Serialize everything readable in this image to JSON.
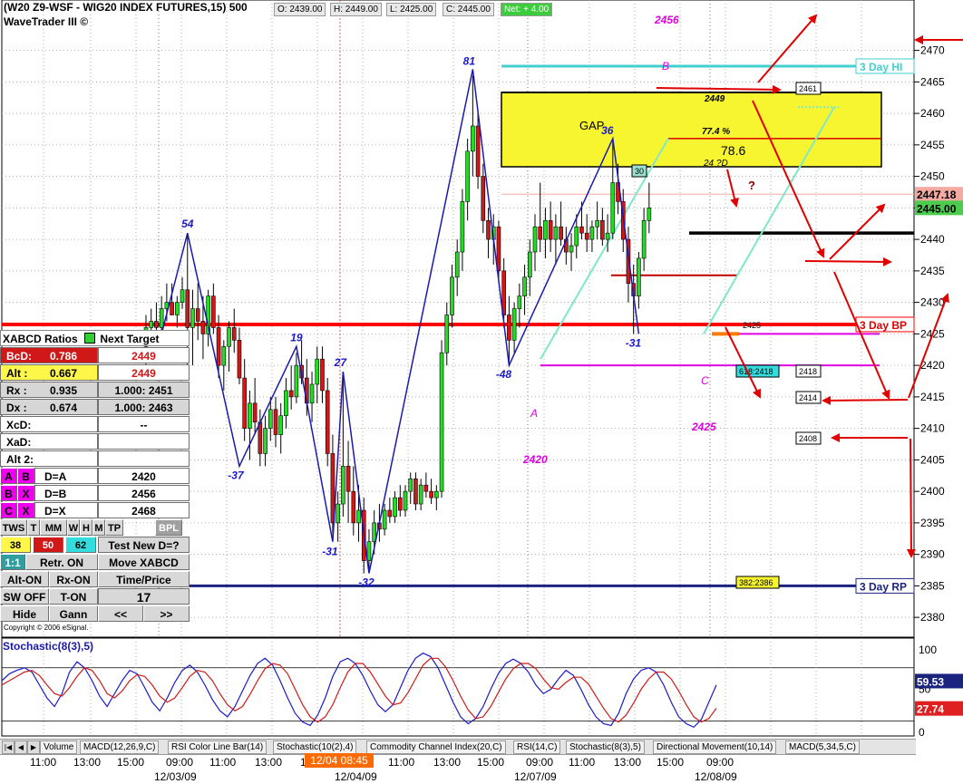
{
  "header": {
    "title": "(W20 Z9-WSF - WIG20 INDEX FUTURES,15) 500",
    "subtitle": "WaveTrader III ©",
    "open": "O: 2439.00",
    "high": "H: 2449.00",
    "low": "L: 2425.00",
    "close": "C: 2445.00",
    "net": "Net: + 4.00"
  },
  "chart_data": [
    {
      "type": "candlestick",
      "title": "(W20 Z9-WSF - WIG20 INDEX FUTURES,15) 500",
      "ylim": [
        2377,
        2478
      ],
      "y_ticks": [
        2380,
        2385,
        2390,
        2395,
        2400,
        2405,
        2410,
        2415,
        2420,
        2425,
        2430,
        2435,
        2440,
        2445,
        2450,
        2455,
        2460,
        2465,
        2470
      ],
      "price_tags": [
        {
          "label": "2447.18",
          "value": 2447.18,
          "color": "#f4a9a1"
        },
        {
          "label": "2445.00",
          "value": 2445,
          "color": "#4ccc4c"
        }
      ],
      "candles": [
        {
          "o": 2423,
          "h": 2428,
          "l": 2420,
          "c": 2426
        },
        {
          "o": 2426,
          "h": 2429,
          "l": 2424,
          "c": 2427
        },
        {
          "o": 2427,
          "h": 2430,
          "l": 2425,
          "c": 2426
        },
        {
          "o": 2426,
          "h": 2431,
          "l": 2424,
          "c": 2429
        },
        {
          "o": 2429,
          "h": 2433,
          "l": 2427,
          "c": 2430
        },
        {
          "o": 2430,
          "h": 2433,
          "l": 2428,
          "c": 2428
        },
        {
          "o": 2428,
          "h": 2431,
          "l": 2426,
          "c": 2430
        },
        {
          "o": 2430,
          "h": 2434,
          "l": 2429,
          "c": 2432
        },
        {
          "o": 2432,
          "h": 2441,
          "l": 2418,
          "c": 2426
        },
        {
          "o": 2426,
          "h": 2432,
          "l": 2420,
          "c": 2429
        },
        {
          "o": 2429,
          "h": 2433,
          "l": 2424,
          "c": 2427
        },
        {
          "o": 2427,
          "h": 2431,
          "l": 2421,
          "c": 2425
        },
        {
          "o": 2425,
          "h": 2432,
          "l": 2423,
          "c": 2431
        },
        {
          "o": 2431,
          "h": 2433,
          "l": 2425,
          "c": 2426
        },
        {
          "o": 2426,
          "h": 2428,
          "l": 2418,
          "c": 2420
        },
        {
          "o": 2420,
          "h": 2424,
          "l": 2416,
          "c": 2423
        },
        {
          "o": 2423,
          "h": 2427,
          "l": 2419,
          "c": 2426
        },
        {
          "o": 2426,
          "h": 2429,
          "l": 2422,
          "c": 2424
        },
        {
          "o": 2424,
          "h": 2426,
          "l": 2417,
          "c": 2418
        },
        {
          "o": 2418,
          "h": 2421,
          "l": 2408,
          "c": 2410
        },
        {
          "o": 2410,
          "h": 2416,
          "l": 2405,
          "c": 2414
        },
        {
          "o": 2414,
          "h": 2418,
          "l": 2409,
          "c": 2411
        },
        {
          "o": 2411,
          "h": 2413,
          "l": 2404,
          "c": 2406
        },
        {
          "o": 2406,
          "h": 2412,
          "l": 2404,
          "c": 2410
        },
        {
          "o": 2410,
          "h": 2415,
          "l": 2408,
          "c": 2413
        },
        {
          "o": 2413,
          "h": 2415,
          "l": 2407,
          "c": 2409
        },
        {
          "o": 2409,
          "h": 2414,
          "l": 2406,
          "c": 2412
        },
        {
          "o": 2412,
          "h": 2418,
          "l": 2410,
          "c": 2416
        },
        {
          "o": 2416,
          "h": 2420,
          "l": 2413,
          "c": 2415
        },
        {
          "o": 2415,
          "h": 2422,
          "l": 2414,
          "c": 2420
        },
        {
          "o": 2420,
          "h": 2424,
          "l": 2417,
          "c": 2418
        },
        {
          "o": 2418,
          "h": 2421,
          "l": 2412,
          "c": 2414
        },
        {
          "o": 2414,
          "h": 2419,
          "l": 2411,
          "c": 2417
        },
        {
          "o": 2417,
          "h": 2423,
          "l": 2414,
          "c": 2421
        },
        {
          "o": 2421,
          "h": 2423,
          "l": 2414,
          "c": 2416
        },
        {
          "o": 2416,
          "h": 2418,
          "l": 2404,
          "c": 2406
        },
        {
          "o": 2406,
          "h": 2409,
          "l": 2393,
          "c": 2395
        },
        {
          "o": 2395,
          "h": 2400,
          "l": 2392,
          "c": 2398
        },
        {
          "o": 2398,
          "h": 2419,
          "l": 2396,
          "c": 2404
        },
        {
          "o": 2404,
          "h": 2408,
          "l": 2395,
          "c": 2400
        },
        {
          "o": 2400,
          "h": 2404,
          "l": 2393,
          "c": 2395
        },
        {
          "o": 2395,
          "h": 2401,
          "l": 2392,
          "c": 2397
        },
        {
          "o": 2397,
          "h": 2399,
          "l": 2387,
          "c": 2389
        },
        {
          "o": 2389,
          "h": 2394,
          "l": 2387,
          "c": 2392
        },
        {
          "o": 2392,
          "h": 2397,
          "l": 2390,
          "c": 2395
        },
        {
          "o": 2395,
          "h": 2398,
          "l": 2392,
          "c": 2394
        },
        {
          "o": 2394,
          "h": 2398,
          "l": 2393,
          "c": 2397
        },
        {
          "o": 2397,
          "h": 2399,
          "l": 2395,
          "c": 2396
        },
        {
          "o": 2396,
          "h": 2400,
          "l": 2395,
          "c": 2399
        },
        {
          "o": 2399,
          "h": 2401,
          "l": 2396,
          "c": 2397
        },
        {
          "o": 2397,
          "h": 2401,
          "l": 2396,
          "c": 2400
        },
        {
          "o": 2400,
          "h": 2403,
          "l": 2398,
          "c": 2402
        },
        {
          "o": 2402,
          "h": 2403,
          "l": 2397,
          "c": 2398
        },
        {
          "o": 2398,
          "h": 2402,
          "l": 2397,
          "c": 2401
        },
        {
          "o": 2401,
          "h": 2403,
          "l": 2399,
          "c": 2400
        },
        {
          "o": 2400,
          "h": 2402,
          "l": 2398,
          "c": 2399
        },
        {
          "o": 2399,
          "h": 2401,
          "l": 2397,
          "c": 2400
        },
        {
          "o": 2400,
          "h": 2424,
          "l": 2399,
          "c": 2422
        },
        {
          "o": 2422,
          "h": 2430,
          "l": 2420,
          "c": 2428
        },
        {
          "o": 2428,
          "h": 2436,
          "l": 2426,
          "c": 2434
        },
        {
          "o": 2434,
          "h": 2440,
          "l": 2431,
          "c": 2438
        },
        {
          "o": 2438,
          "h": 2448,
          "l": 2435,
          "c": 2446
        },
        {
          "o": 2446,
          "h": 2456,
          "l": 2443,
          "c": 2454
        },
        {
          "o": 2454,
          "h": 2466,
          "l": 2450,
          "c": 2458
        },
        {
          "o": 2458,
          "h": 2460,
          "l": 2448,
          "c": 2450
        },
        {
          "o": 2450,
          "h": 2452,
          "l": 2441,
          "c": 2443
        },
        {
          "o": 2443,
          "h": 2445,
          "l": 2437,
          "c": 2440
        },
        {
          "o": 2440,
          "h": 2444,
          "l": 2436,
          "c": 2442
        },
        {
          "o": 2442,
          "h": 2443,
          "l": 2433,
          "c": 2435
        },
        {
          "o": 2435,
          "h": 2437,
          "l": 2426,
          "c": 2428
        },
        {
          "o": 2428,
          "h": 2431,
          "l": 2420,
          "c": 2424
        },
        {
          "o": 2424,
          "h": 2430,
          "l": 2422,
          "c": 2429
        },
        {
          "o": 2429,
          "h": 2433,
          "l": 2426,
          "c": 2431
        },
        {
          "o": 2431,
          "h": 2436,
          "l": 2428,
          "c": 2434
        },
        {
          "o": 2434,
          "h": 2440,
          "l": 2431,
          "c": 2438
        },
        {
          "o": 2438,
          "h": 2444,
          "l": 2435,
          "c": 2442
        },
        {
          "o": 2442,
          "h": 2449,
          "l": 2438,
          "c": 2440
        },
        {
          "o": 2440,
          "h": 2445,
          "l": 2437,
          "c": 2443
        },
        {
          "o": 2443,
          "h": 2446,
          "l": 2438,
          "c": 2440
        },
        {
          "o": 2440,
          "h": 2444,
          "l": 2436,
          "c": 2442
        },
        {
          "o": 2442,
          "h": 2446,
          "l": 2439,
          "c": 2440
        },
        {
          "o": 2440,
          "h": 2442,
          "l": 2436,
          "c": 2438
        },
        {
          "o": 2438,
          "h": 2441,
          "l": 2435,
          "c": 2439
        },
        {
          "o": 2439,
          "h": 2444,
          "l": 2437,
          "c": 2442
        },
        {
          "o": 2442,
          "h": 2446,
          "l": 2440,
          "c": 2441
        },
        {
          "o": 2441,
          "h": 2444,
          "l": 2438,
          "c": 2440
        },
        {
          "o": 2440,
          "h": 2443,
          "l": 2438,
          "c": 2442
        },
        {
          "o": 2442,
          "h": 2446,
          "l": 2440,
          "c": 2443
        },
        {
          "o": 2443,
          "h": 2445,
          "l": 2439,
          "c": 2440
        },
        {
          "o": 2440,
          "h": 2444,
          "l": 2438,
          "c": 2441
        },
        {
          "o": 2441,
          "h": 2456,
          "l": 2440,
          "c": 2449
        },
        {
          "o": 2449,
          "h": 2452,
          "l": 2444,
          "c": 2446
        },
        {
          "o": 2446,
          "h": 2448,
          "l": 2438,
          "c": 2440
        },
        {
          "o": 2440,
          "h": 2442,
          "l": 2430,
          "c": 2433
        },
        {
          "o": 2433,
          "h": 2436,
          "l": 2425,
          "c": 2431
        },
        {
          "o": 2431,
          "h": 2438,
          "l": 2429,
          "c": 2437
        },
        {
          "o": 2437,
          "h": 2445,
          "l": 2435,
          "c": 2443
        },
        {
          "o": 2443,
          "h": 2449,
          "l": 2441,
          "c": 2445
        }
      ],
      "wave_points": [
        {
          "i": 3,
          "v": 2425,
          "label": ""
        },
        {
          "i": 8,
          "v": 2441,
          "label": "54"
        },
        {
          "i": 18,
          "v": 2404,
          "label": "-37"
        },
        {
          "i": 29,
          "v": 2423,
          "label": "19"
        },
        {
          "i": 36,
          "v": 2392,
          "label": "-31"
        },
        {
          "i": 38,
          "v": 2419,
          "label": "27"
        },
        {
          "i": 43,
          "v": 2387,
          "label": "-32"
        },
        {
          "i": 63,
          "v": 2467,
          "label": "81"
        },
        {
          "i": 70,
          "v": 2420,
          "label": "-48"
        },
        {
          "i": 90,
          "v": 2456,
          "label": "36"
        },
        {
          "i": 95,
          "v": 2425,
          "label": "-31"
        }
      ],
      "level_lines": [
        {
          "label": "3 Day HI",
          "value": 2467.5,
          "color": "#40d0d0"
        },
        {
          "label": "3 Day BP",
          "value": 2426.5,
          "color": "#ff0000"
        },
        {
          "label": "3 Day RP",
          "value": 2385,
          "color": "#1a237e"
        }
      ],
      "annotations": {
        "gap": "GAP",
        "gap_value": "2449",
        "pct": "77.4 %",
        "ratio": "78.6",
        "d_label": "24 ?D",
        "q": "?",
        "t2456": "2456",
        "b": "B",
        "a": "A",
        "c": "C",
        "t2420": "2420",
        "t2425": "2425",
        "box30": "30",
        "t2425b": "2425",
        "b2461": "2461",
        "b2418a": "618:2418",
        "b2418": "2418",
        "b2414": "2414",
        "b2408": "2408",
        "b382": "382:2386"
      }
    },
    {
      "type": "line",
      "title": "Stochastic(8(3),5)",
      "ylim": [
        0,
        100
      ],
      "y_ticks": [
        0,
        50,
        100
      ],
      "series": [
        {
          "name": "%K",
          "color": "#1a1acc",
          "values": [
            60,
            68,
            72,
            75,
            70,
            55,
            40,
            30,
            45,
            70,
            82,
            75,
            60,
            42,
            30,
            45,
            60,
            72,
            68,
            52,
            35,
            25,
            40,
            58,
            72,
            78,
            70,
            55,
            38,
            25,
            18,
            30,
            48,
            66,
            80,
            86,
            78,
            60,
            40,
            22,
            12,
            8,
            20,
            40,
            65,
            82,
            86,
            80,
            66,
            48,
            32,
            24,
            32,
            52,
            72,
            86,
            92,
            88,
            75,
            55,
            35,
            18,
            10,
            16,
            30,
            50,
            68,
            80,
            85,
            80,
            70,
            55,
            45,
            50,
            62,
            72,
            66,
            50,
            32,
            18,
            10,
            8,
            22,
            45,
            62,
            72,
            75,
            70,
            55,
            35,
            18,
            10,
            6,
            15,
            35,
            55
          ]
        },
        {
          "name": "%D",
          "color": "#d01a1a",
          "values": [
            55,
            60,
            65,
            70,
            72,
            66,
            55,
            45,
            42,
            52,
            65,
            75,
            72,
            60,
            45,
            40,
            48,
            60,
            67,
            65,
            55,
            42,
            35,
            40,
            52,
            65,
            72,
            70,
            60,
            45,
            32,
            25,
            30,
            44,
            60,
            74,
            80,
            78,
            68,
            50,
            32,
            18,
            12,
            18,
            32,
            52,
            70,
            80,
            80,
            70,
            56,
            42,
            32,
            34,
            46,
            62,
            78,
            86,
            86,
            76,
            60,
            42,
            26,
            16,
            18,
            30,
            46,
            62,
            74,
            80,
            80,
            74,
            62,
            52,
            50,
            58,
            64,
            64,
            56,
            42,
            28,
            16,
            12,
            20,
            34,
            50,
            62,
            70,
            70,
            62,
            48,
            32,
            18,
            12,
            16,
            28
          ]
        }
      ],
      "tags": [
        {
          "label": "59.53",
          "color": "#1a237e"
        },
        {
          "label": "27.74",
          "color": "#e02020"
        }
      ]
    }
  ],
  "panel": {
    "title": "XABCD Ratios",
    "next_target": "Next Target",
    "rows": [
      {
        "k": "BcD:",
        "v": "0.786",
        "t": "2449"
      },
      {
        "k": "Alt :",
        "v": "0.667",
        "t": "2449"
      },
      {
        "k": "Rx :",
        "v": "0.935",
        "t": "1.000: 2451"
      },
      {
        "k": "Dx :",
        "v": "0.674",
        "t": "1.000: 2463"
      },
      {
        "k": "XcD:",
        "v": "",
        "t": "--"
      },
      {
        "k": "XaD:",
        "v": "",
        "t": ""
      },
      {
        "k": "Alt 2:",
        "v": "",
        "t": ""
      }
    ],
    "targets": [
      {
        "a": "A",
        "b": "B",
        "eq": "D=A",
        "v": "2420"
      },
      {
        "a": "B",
        "b": "X",
        "eq": "D=B",
        "v": "2456"
      },
      {
        "a": "C",
        "b": "X",
        "eq": "D=X",
        "v": "2468"
      }
    ],
    "tools_row": [
      "TWS",
      "T",
      "MM",
      "W",
      "H",
      "M",
      "TP",
      "BPL"
    ],
    "small_vals": [
      "38",
      "50",
      "62"
    ],
    "new_d": "Test New D=?",
    "b11": "1:1",
    "retr": "Retr. ON",
    "move": "Move XABCD",
    "alt_on": "Alt-ON",
    "rx_on": "Rx-ON",
    "time_price": "Time/Price",
    "sw_off": "SW OFF",
    "t_on": "T-ON",
    "count": "17",
    "hide": "Hide",
    "gann": "Gann",
    "prev": "<<",
    "next": ">>"
  },
  "copyright": "Copyright © 2006 eSignal.",
  "stoch_label": "Stochastic(8(3),5)",
  "tabs": [
    "Volume",
    "MACD(12,26,9,C)",
    "RSI Color Line Bar(14)",
    "Stochastic(10(2),4)",
    "Commodity Channel Index(20,C)",
    "RSI(14,C)",
    "Stochastic(8(3),5)",
    "Directional Movement(10,14)",
    "MACD(5,34,5,C)"
  ],
  "time_labels": [
    "11:00",
    "13:00",
    "15:00",
    "09:00",
    "11:00",
    "13:00",
    "15:00",
    "11:00",
    "13:00",
    "15:00",
    "09:00",
    "11:00",
    "13:00",
    "15:00",
    "09:00"
  ],
  "time_badge": "12/04 08:45",
  "date_labels": [
    "12/03/09",
    "12/04/09",
    "12/07/09",
    "12/08/09"
  ]
}
